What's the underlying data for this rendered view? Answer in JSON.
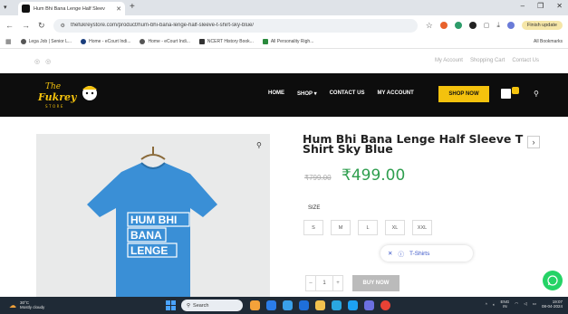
{
  "browser": {
    "tab_title": "Hum Bhi Bana Lenge Half Sleev",
    "url": "thefukreystore.com/product/hum-bhi-bana-lenge-half-sleeve-t-shirt-sky-blue/",
    "update_label": "Finish update",
    "bookmarks": [
      "Lega Job | Senior L...",
      "Home - eCourt Indi...",
      "Home - eCourt Indi...",
      "NCERT History Book...",
      "All Personality Righ..."
    ],
    "all_bookmarks": "All Bookmarks"
  },
  "site": {
    "top_links": [
      "My Account",
      "Shopping Cart",
      "Contact Us"
    ],
    "nav": [
      "HOME",
      "SHOP ▾",
      "CONTACT US",
      "MY ACCOUNT"
    ],
    "shop_now": "SHOP NOW",
    "logo_text": [
      "The",
      "Fukrey",
      "STORE"
    ]
  },
  "product": {
    "title": "Hum Bhi Bana Lenge Half Sleeve T – Shirt Sky Blue",
    "old_price": "₹799.00",
    "price": "₹499.00",
    "size_label": "SIZE",
    "sizes": [
      "S",
      "M",
      "L",
      "XL",
      "XXL"
    ],
    "shirt_text": [
      "HUM BHI",
      "BANA",
      "LENGE"
    ],
    "filter_chip": "T-Shirts",
    "qty_minus": "–",
    "qty_value": "1",
    "qty_plus": "+",
    "buy_now": "BUY NOW",
    "arrow": "›"
  },
  "taskbar": {
    "weather_temp": "30°C",
    "weather_desc": "Mostly cloudy",
    "search_label": "Search",
    "lang": "ENG",
    "region": "IN",
    "time": "19:07",
    "date": "08-04-2024"
  },
  "colors": {
    "header_bg": "#0d0d0d",
    "shop_now_bg": "#f4c20d",
    "price_green": "#2e9e4e",
    "shirt_blue": "#3a8fd6"
  }
}
